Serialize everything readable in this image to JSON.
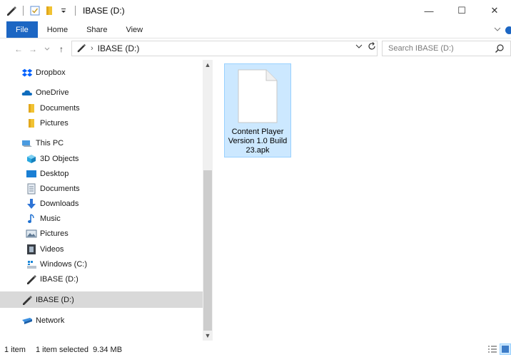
{
  "titlebar": {
    "title": "IBASE (D:)",
    "icons": [
      "drive-pen-icon",
      "checkbox-icon",
      "folder-icon",
      "dropdown-arrow-icon"
    ],
    "minimize": "—",
    "maximize": "☐",
    "close": "✕"
  },
  "ribbon": {
    "tabs": [
      "File",
      "Home",
      "Share",
      "View"
    ]
  },
  "address": {
    "path": "IBASE (D:)",
    "search_placeholder": "Search IBASE (D:)"
  },
  "nav": {
    "items": [
      {
        "label": "Dropbox",
        "icon": "dropbox-icon"
      },
      {
        "label": "OneDrive",
        "icon": "cloud-icon"
      },
      {
        "label": "Documents",
        "icon": "folder-icon"
      },
      {
        "label": "Pictures",
        "icon": "folder-icon"
      },
      {
        "label": "This PC",
        "icon": "computer-icon"
      },
      {
        "label": "3D Objects",
        "icon": "cube-icon"
      },
      {
        "label": "Desktop",
        "icon": "desktop-icon"
      },
      {
        "label": "Documents",
        "icon": "document-icon"
      },
      {
        "label": "Downloads",
        "icon": "download-icon"
      },
      {
        "label": "Music",
        "icon": "music-note-icon"
      },
      {
        "label": "Pictures",
        "icon": "pictures-icon"
      },
      {
        "label": "Videos",
        "icon": "film-icon"
      },
      {
        "label": "Windows (C:)",
        "icon": "windows-drive-icon"
      },
      {
        "label": "IBASE (D:)",
        "icon": "drive-pen-icon"
      },
      {
        "label": "IBASE (D:)",
        "icon": "drive-pen-icon",
        "selected": true
      },
      {
        "label": "Network",
        "icon": "network-icon"
      }
    ]
  },
  "content": {
    "files": [
      {
        "name": "Content Player Version 1.0 Build 23.apk",
        "icon": "blank-file-icon",
        "selected": true
      }
    ]
  },
  "status": {
    "count": "1 item",
    "selection": "1 item selected  9.34 MB"
  },
  "colors": {
    "accent": "#1c66c3",
    "selection_bg": "#cce8ff",
    "selection_border": "#99d1ff",
    "nav_selected_bg": "#d9d9d9"
  }
}
